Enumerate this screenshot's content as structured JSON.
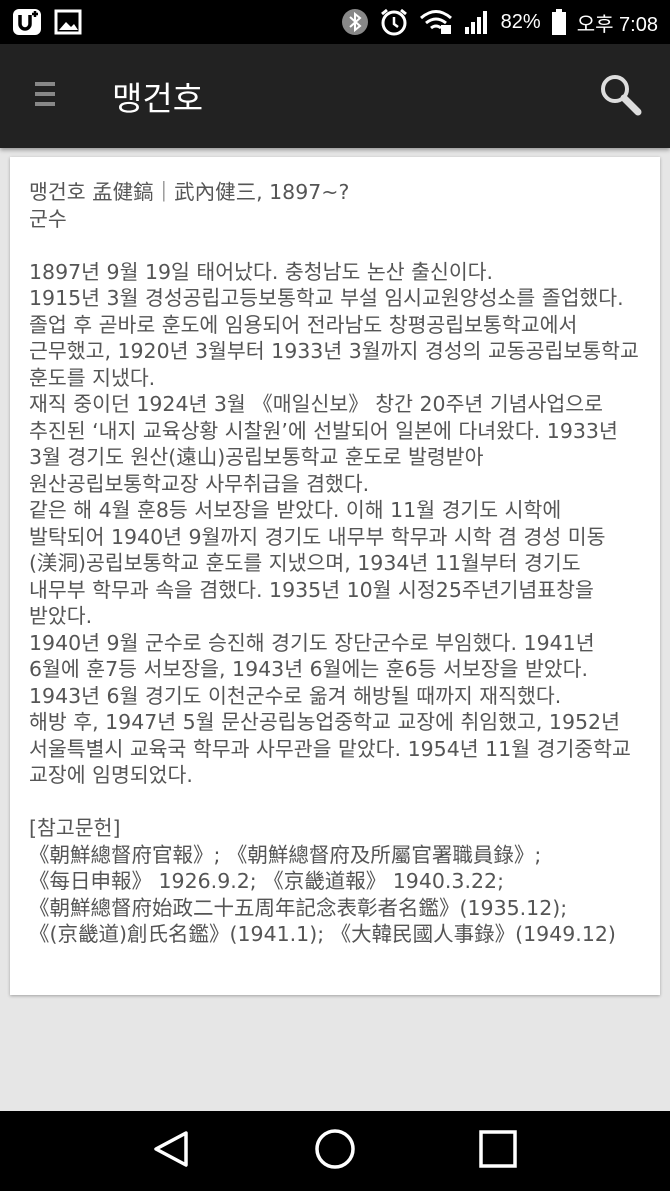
{
  "status_bar": {
    "battery_percent": "82%",
    "time": "오후 7:08",
    "icons": [
      "u-plus-icon",
      "image-icon",
      "bluetooth-icon",
      "alarm-icon",
      "wifi-icon",
      "signal-icon",
      "battery-icon"
    ]
  },
  "app_bar": {
    "title": "맹건호",
    "icons": [
      "menu-icon",
      "search-icon"
    ]
  },
  "article": {
    "header_line1": "맹건호 孟健鎬｜武內健三, 1897~?",
    "header_line2": "군수",
    "body": [
      "1897년 9월 19일 태어났다. 충청남도 논산 출신이다.",
      "1915년 3월 경성공립고등보통학교 부설 임시교원양성소를 졸업했다. 졸업 후 곧바로 훈도에 임용되어 전라남도 창평공립보통학교에서 근무했고, 1920년 3월부터 1933년 3월까지 경성의 교동공립보통학교 훈도를 지냈다.",
      "재직 중이던 1924년 3월 《매일신보》 창간 20주년 기념사업으로 추진된 ‘내지 교육상황 시찰원’에 선발되어 일본에 다녀왔다. 1933년 3월 경기도 원산(遠山)공립보통학교 훈도로 발령받아 원산공립보통학교장 사무취급을 겸했다.",
      "같은 해 4월 훈8등 서보장을 받았다. 이해 11월 경기도 시학에 발탁되어 1940년 9월까지 경기도 내무부 학무과 시학 겸 경성 미동(渼洞)공립보통학교 훈도를 지냈으며, 1934년 11월부터 경기도 내무부 학무과 속을 겸했다. 1935년 10월 시정25주년기념표창을 받았다.",
      "1940년 9월 군수로 승진해 경기도 장단군수로 부임했다. 1941년 6월에 훈7등 서보장을, 1943년 6월에는 훈6등 서보장을 받았다. 1943년 6월 경기도 이천군수로 옮겨 해방될 때까지 재직했다.",
      "해방 후, 1947년 5월 문산공립농업중학교 교장에 취임했고, 1952년 서울특별시 교육국 학무과 사무관을 맡았다. 1954년 11월 경기중학교 교장에 임명되었다."
    ],
    "references_title": "[참고문헌]",
    "references": "《朝鮮總督府官報》; 《朝鮮總督府及所屬官署職員錄》; 《每日申報》 1926.9.2; 《京畿道報》 1940.3.22; 《朝鮮總督府始政二十五周年記念表彰者名鑑》(1935.12); 《(京畿道)創氏名鑑》(1941.1); 《大韓民國人事錄》(1949.12)"
  },
  "nav_bar": {
    "icons": [
      "back-icon",
      "home-icon",
      "recents-icon"
    ]
  },
  "colors": {
    "status_bar": "#000000",
    "app_bar": "#222222",
    "background": "#e6e6e6",
    "card": "#ffffff",
    "text": "#555555"
  }
}
